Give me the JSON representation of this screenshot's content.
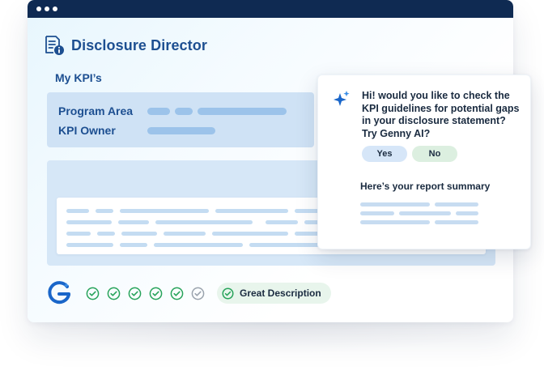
{
  "app": {
    "title": "Disclosure Director",
    "icon": "document-info-icon"
  },
  "kpis": {
    "section_title": "My  KPI’s",
    "fields": [
      {
        "label": "Program Area"
      },
      {
        "label": "KPI Owner"
      }
    ]
  },
  "footer": {
    "logo": "genny-g-logo",
    "checks": [
      {
        "icon": "check-circle-icon",
        "state": "done"
      },
      {
        "icon": "check-circle-icon",
        "state": "done"
      },
      {
        "icon": "check-circle-icon",
        "state": "done"
      },
      {
        "icon": "check-circle-icon",
        "state": "done"
      },
      {
        "icon": "check-circle-icon",
        "state": "done"
      },
      {
        "icon": "check-circle-icon",
        "state": "pending"
      }
    ],
    "badge_label": "Great Description"
  },
  "assistant": {
    "icon": "sparkle-icon",
    "message": "Hi! would you like to check the KPI guidelines for potential gaps in your disclosure statement? Try Genny AI?",
    "yes_label": "Yes",
    "no_label": "No",
    "summary_title": "Here’s your report summary"
  },
  "colors": {
    "titlebar": "#0f2a52",
    "brand_blue": "#1d4f91",
    "check_green": "#27a35a",
    "check_gray": "#9aa3ad",
    "yes_bg": "#d6e6f8",
    "no_bg": "#dcefe0"
  }
}
